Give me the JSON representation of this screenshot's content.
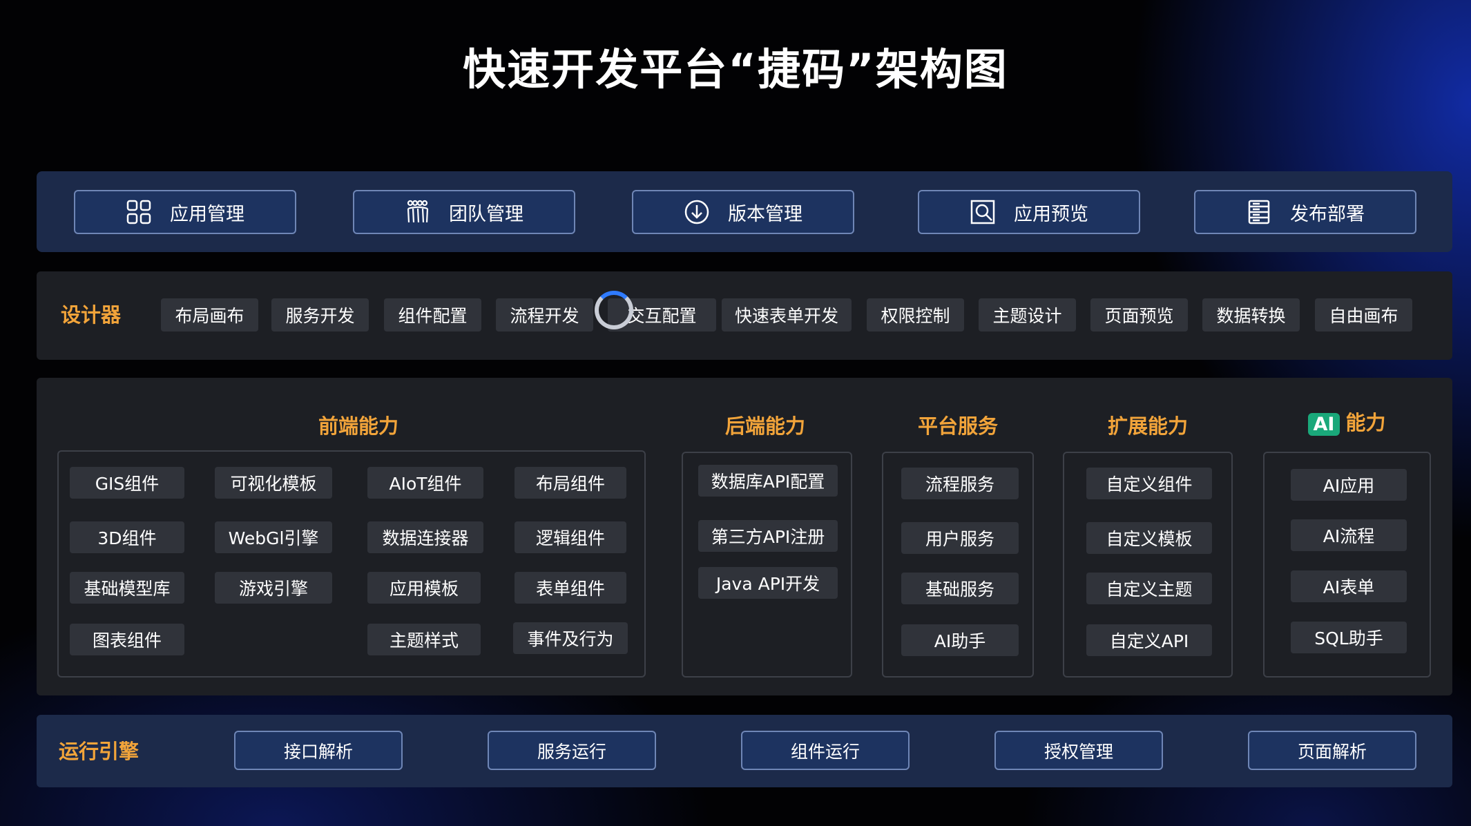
{
  "title": "快速开发平台“捷码”架构图",
  "top_nav": [
    {
      "label": "应用管理",
      "icon": "grid-icon"
    },
    {
      "label": "团队管理",
      "icon": "team-icon"
    },
    {
      "label": "版本管理",
      "icon": "download-icon"
    },
    {
      "label": "应用预览",
      "icon": "preview-icon"
    },
    {
      "label": "发布部署",
      "icon": "server-icon"
    }
  ],
  "designer": {
    "label": "设计器",
    "items": [
      "布局画布",
      "服务开发",
      "组件配置",
      "流程开发",
      "交互配置",
      "快速表单开发",
      "权限控制",
      "主题设计",
      "页面预览",
      "数据转换",
      "自由画布"
    ]
  },
  "frontend": {
    "title": "前端能力",
    "items": [
      "GIS组件",
      "可视化模板",
      "AIoT组件",
      "布局组件",
      "3D组件",
      "WebGl引擎",
      "数据连接器",
      "逻辑组件",
      "基础模型库",
      "游戏引擎",
      "应用模板",
      "表单组件",
      "图表组件",
      "主题样式",
      "事件及行为"
    ]
  },
  "backend": {
    "title": "后端能力",
    "items": [
      "数据库API配置",
      "第三方API注册",
      "Java API开发"
    ]
  },
  "platform": {
    "title": "平台服务",
    "items": [
      "流程服务",
      "用户服务",
      "基础服务",
      "AI助手"
    ]
  },
  "extension": {
    "title": "扩展能力",
    "items": [
      "自定义组件",
      "自定义模板",
      "自定义主题",
      "自定义API"
    ]
  },
  "ai": {
    "badge": "AI",
    "title": "能力",
    "items": [
      "AI应用",
      "AI流程",
      "AI表单",
      "SQL助手"
    ]
  },
  "runtime": {
    "label": "运行引擎",
    "items": [
      "接口解析",
      "服务运行",
      "组件运行",
      "授权管理",
      "页面解析"
    ]
  },
  "colors": {
    "accent": "#f2a43a",
    "nav_bar": "#1c2a4a",
    "button_bg": "#1d3360",
    "panel_bg": "#1d1f24",
    "chip_bg": "#30333a",
    "ai_badge": "#1aa87a"
  }
}
